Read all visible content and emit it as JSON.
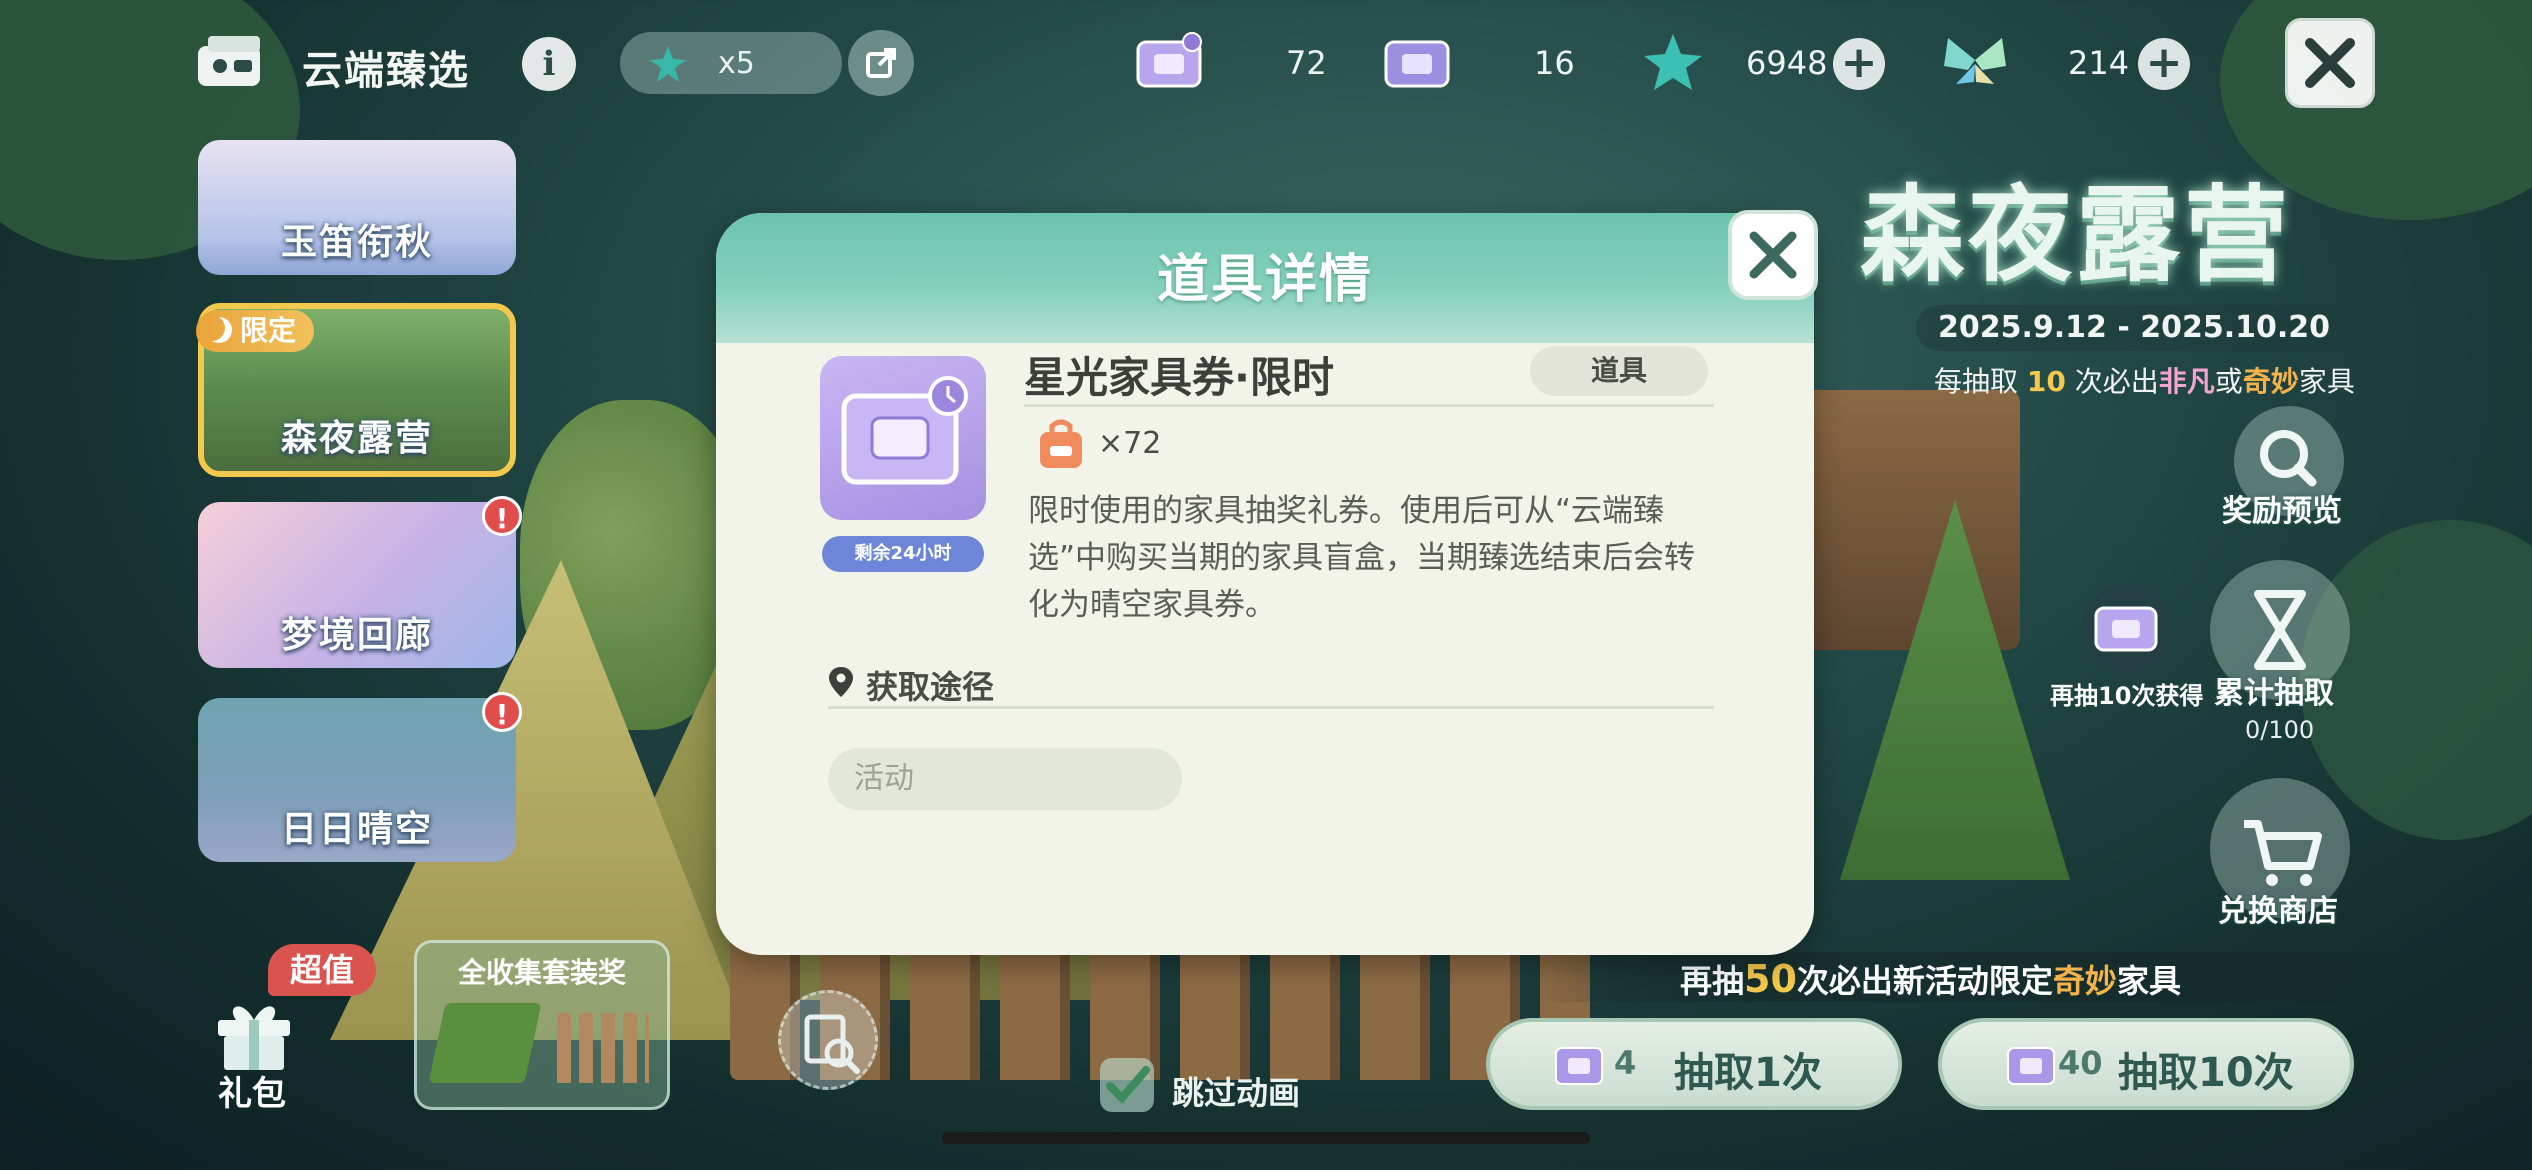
{
  "header": {
    "title": "云端臻选",
    "info_label": "i",
    "ticket_count": "x5",
    "currencies": [
      {
        "icon": "limited-furniture-ticket-icon",
        "value": "72"
      },
      {
        "icon": "furniture-ticket-icon",
        "value": "16"
      },
      {
        "icon": "star-gem-icon",
        "value": "6948"
      },
      {
        "icon": "butterfly-gem-icon",
        "value": "214"
      }
    ],
    "plus_label": "+"
  },
  "banners": [
    {
      "label": "玉笛衔秋"
    },
    {
      "label": "森夜露营",
      "tag": "限定"
    },
    {
      "label": "梦境回廊",
      "alert": "!"
    },
    {
      "label": "日日晴空",
      "alert": "!"
    }
  ],
  "bottom_left": {
    "super_badge": "超值",
    "gift_label": "礼包",
    "collect_title": "全收集套装奖",
    "skip_label": "跳过动画"
  },
  "event": {
    "title": "森夜露营",
    "date": "2025.9.12 - 2025.10.20",
    "note_pre": "每抽取 ",
    "note_num": "10",
    "note_mid": " 次必出",
    "note_rare1": "非凡",
    "note_or": "或",
    "note_rare2": "奇妙",
    "note_post": "家具"
  },
  "side": {
    "preview_label": "奖励预览",
    "more10_label": "再抽10次获得",
    "cumulative_label": "累计抽取",
    "cumulative_count": "0/100",
    "shop_label": "兑换商店"
  },
  "notice": {
    "pre": "再抽",
    "num": "50",
    "mid": "次必出新活动限定",
    "rare": "奇妙",
    "post": "家具"
  },
  "draw": {
    "single_cost": "4",
    "single_label": "抽取1次",
    "ten_cost": "40",
    "ten_label": "抽取10次"
  },
  "modal": {
    "title": "道具详情",
    "item_name": "星光家具券·限时",
    "item_type": "道具",
    "timer": "剩余24小时",
    "quantity": "×72",
    "description": "限时使用的家具抽奖礼券。使用后可从“云端臻选”中购买当期的家具盲盒，当期臻选结束后会转化为晴空家具券。",
    "route_label": "获取途径",
    "route_item": "活动"
  },
  "colors": {
    "modal_header": "#6cc4ad",
    "modal_bg": "#f2f4ea",
    "accent_yellow": "#f6c94d",
    "alert_red": "#e04d4d",
    "timer_blue": "#6d86d8"
  }
}
